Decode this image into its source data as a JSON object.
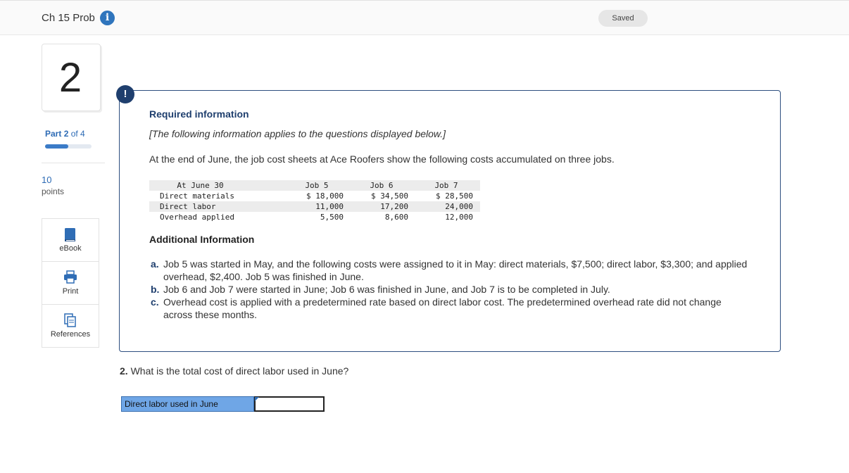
{
  "header": {
    "title": "Ch 15 Prob",
    "info_icon": "info-icon",
    "saved_label": "Saved"
  },
  "sidebar": {
    "question_number": "2",
    "part_prefix": "Part",
    "part_current": "2",
    "part_of": "of 4",
    "progress_fraction": 0.5,
    "points_value": "10",
    "points_label": "points",
    "tools": [
      {
        "label": "eBook",
        "icon": "book-icon"
      },
      {
        "label": "Print",
        "icon": "printer-icon"
      },
      {
        "label": "References",
        "icon": "documents-icon"
      }
    ]
  },
  "info": {
    "alert_glyph": "!",
    "heading": "Required information",
    "note": "[The following information applies to the questions displayed below.]",
    "intro": "At the end of June, the job cost sheets at Ace Roofers show the following costs accumulated on three jobs.",
    "table": {
      "headers": [
        "At June 30",
        "Job 5",
        "Job 6",
        "Job 7"
      ],
      "rows": [
        [
          "Direct materials",
          "$ 18,000",
          "$ 34,500",
          "$ 28,500"
        ],
        [
          "Direct labor",
          "11,000",
          "17,200",
          "24,000"
        ],
        [
          "Overhead applied",
          "5,500",
          "8,600",
          "12,000"
        ]
      ]
    },
    "additional_heading": "Additional Information",
    "items": [
      {
        "marker": "a.",
        "text": "Job 5 was started in May, and the following costs were assigned to it in May: direct materials, $7,500; direct labor, $3,300; and applied overhead, $2,400. Job 5 was finished in June."
      },
      {
        "marker": "b.",
        "text": "Job 6 and Job 7 were started in June; Job 6 was finished in June, and Job 7 is to be completed in July."
      },
      {
        "marker": "c.",
        "text": "Overhead cost is applied with a predetermined rate based on direct labor cost. The predetermined overhead rate did not change across these months."
      }
    ]
  },
  "question": {
    "number": "2.",
    "text": "What is the total cost of direct labor used in June?"
  },
  "answer": {
    "label": "Direct labor used in June",
    "value": ""
  },
  "colors": {
    "accent_blue": "#2f75bd",
    "navy": "#1f3f6e",
    "answer_label_bg": "#6fa6e6"
  }
}
